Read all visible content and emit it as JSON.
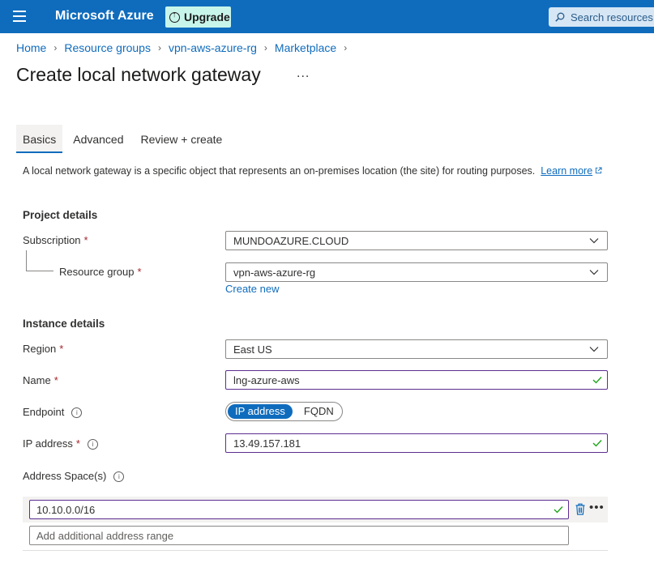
{
  "topbar": {
    "brand": "Microsoft Azure",
    "upgrade_label": "Upgrade",
    "search_placeholder": "Search resources,"
  },
  "breadcrumb": [
    "Home",
    "Resource groups",
    "vpn-aws-azure-rg",
    "Marketplace"
  ],
  "page": {
    "title": "Create local network gateway",
    "more": "..."
  },
  "tabs": [
    {
      "label": "Basics",
      "active": true
    },
    {
      "label": "Advanced",
      "active": false
    },
    {
      "label": "Review + create",
      "active": false
    }
  ],
  "description": {
    "text": "A local network gateway is a specific object that represents an on-premises location (the site) for routing purposes.",
    "learn_more": "Learn more"
  },
  "project_details": {
    "title": "Project details",
    "subscription_label": "Subscription",
    "subscription_value": "MUNDOAZURE.CLOUD",
    "resource_group_label": "Resource group",
    "resource_group_value": "vpn-aws-azure-rg",
    "create_new": "Create new"
  },
  "instance_details": {
    "title": "Instance details",
    "region_label": "Region",
    "region_value": "East US",
    "name_label": "Name",
    "name_value": "lng-azure-aws",
    "endpoint_label": "Endpoint",
    "endpoint_options": [
      "IP address",
      "FQDN"
    ],
    "endpoint_selected": "IP address",
    "ip_label": "IP address",
    "ip_value": "13.49.157.181",
    "address_space_label": "Address Space(s)",
    "address_spaces": [
      "10.10.0.0/16"
    ],
    "add_range_placeholder": "Add additional address range"
  },
  "required_marker": "*",
  "colors": {
    "topbar": "#0f6cbd",
    "accent": "#0f6cbd",
    "valid_border": "#5c2e91",
    "check": "#13a10e",
    "required": "#a4262c"
  },
  "icons": [
    "hamburger-icon",
    "upgrade-icon",
    "search-icon",
    "external-link-icon",
    "chevron-down-icon",
    "checkmark-icon",
    "info-icon",
    "trash-icon",
    "ellipsis-icon"
  ]
}
